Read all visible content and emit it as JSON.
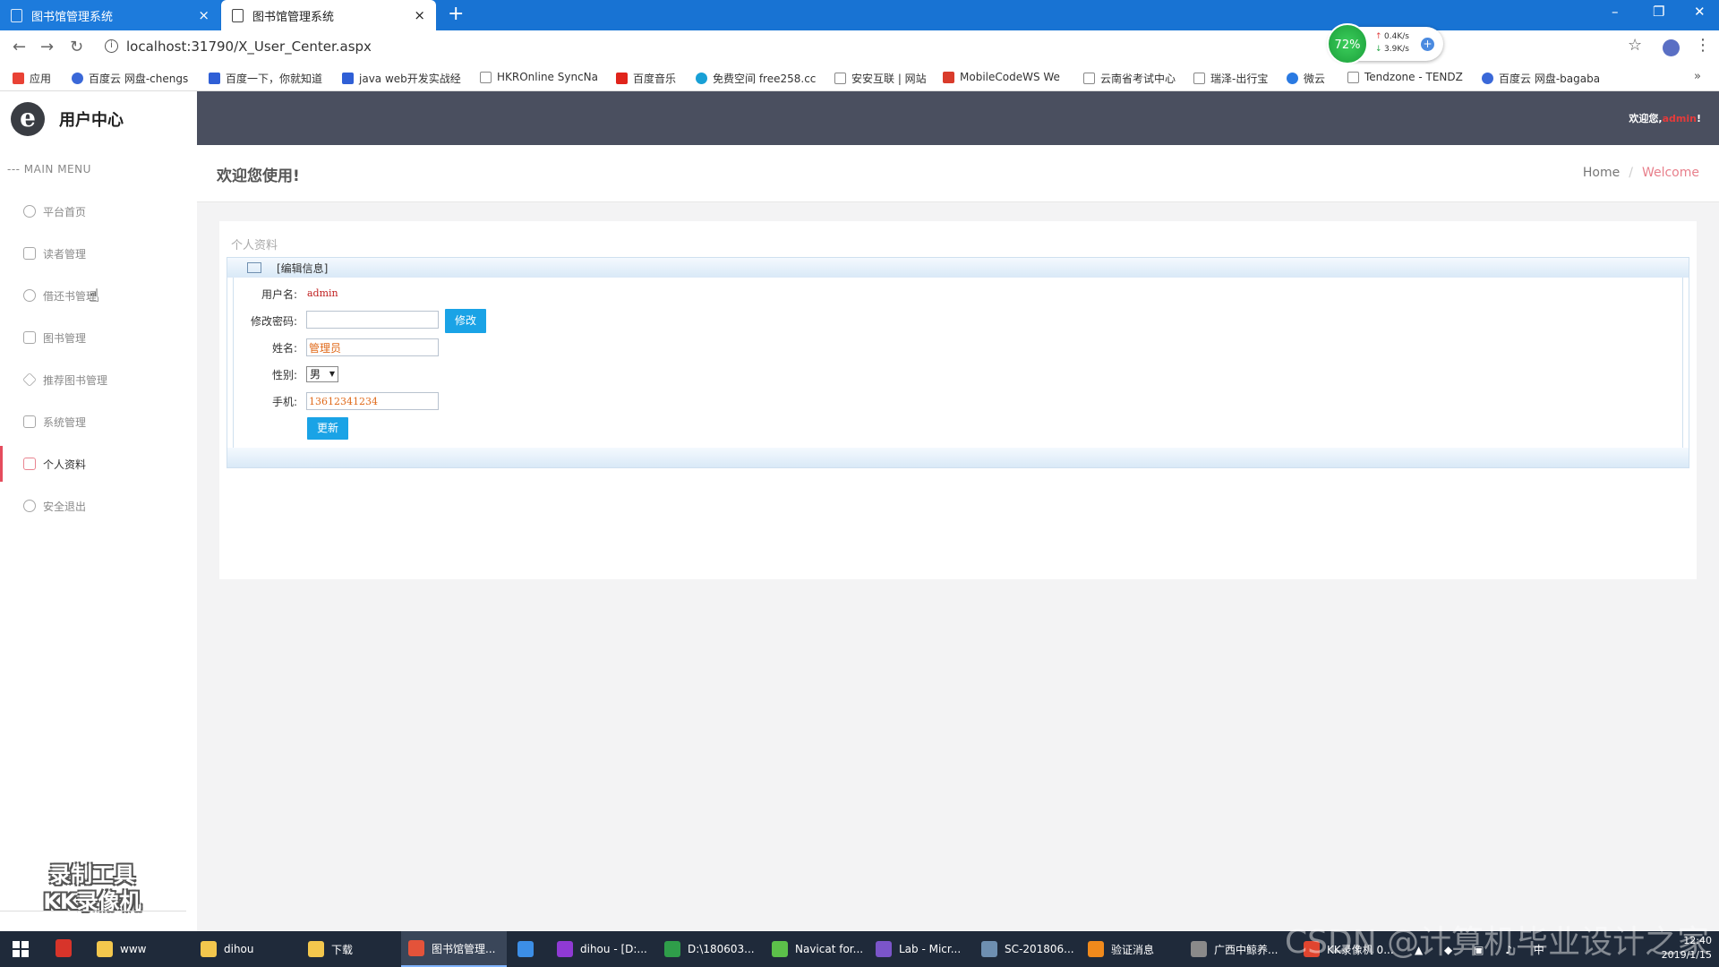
{
  "browser": {
    "tabs": [
      {
        "title": "图书馆管理系统",
        "active": false
      },
      {
        "title": "图书馆管理系统",
        "active": true
      }
    ],
    "new_tab": "+",
    "url": "localhost:31790/X_User_Center.aspx",
    "speed": {
      "percent": "72%",
      "up": "0.4K/s",
      "down": "3.9K/s"
    },
    "bookmarks": [
      {
        "label": "应用",
        "icon": "apps-grid-icon",
        "color": "#e94235"
      },
      {
        "label": "百度云 网盘-chengs",
        "icon": "baidu-cloud-icon",
        "color": "#3a68d8"
      },
      {
        "label": "百度一下，你就知道",
        "icon": "baidu-paw-icon",
        "color": "#2f5fd6"
      },
      {
        "label": "java web开发实战经",
        "icon": "baidu-paw-icon",
        "color": "#2f5fd6"
      },
      {
        "label": "HKROnline SyncNa",
        "icon": "page-icon",
        "color": "#888888"
      },
      {
        "label": "百度音乐",
        "icon": "music-icon",
        "color": "#e0241b"
      },
      {
        "label": "免费空间 free258.cc",
        "icon": "circle-icon",
        "color": "#18a0d6"
      },
      {
        "label": "安安互联 | 网站",
        "icon": "page-icon",
        "color": "#888888"
      },
      {
        "label": "MobileCodeWS We",
        "icon": "mobilecode-icon",
        "color": "#d93b2b"
      },
      {
        "label": "云南省考试中心",
        "icon": "page-icon",
        "color": "#888888"
      },
      {
        "label": "瑞泽-出行宝",
        "icon": "page-icon",
        "color": "#888888"
      },
      {
        "label": "微云",
        "icon": "weiyun-icon",
        "color": "#2a7ae2"
      },
      {
        "label": "Tendzone - TENDZ",
        "icon": "page-icon",
        "color": "#888888"
      },
      {
        "label": "百度云 网盘-bagaba",
        "icon": "baidu-cloud-icon",
        "color": "#3a68d8"
      }
    ],
    "bookmarks_more": "»"
  },
  "sidebar": {
    "title": "用户中心",
    "logo_letter": "e",
    "menu_header": "--- MAIN MENU",
    "items": [
      {
        "label": "平台首页",
        "icon": "eye-icon",
        "active": false
      },
      {
        "label": "读者管理",
        "icon": "cloud-icon",
        "active": false
      },
      {
        "label": "借还书管理",
        "icon": "compass-icon",
        "active": false
      },
      {
        "label": "图书管理",
        "icon": "trophy-icon",
        "active": false
      },
      {
        "label": "推荐图书管理",
        "icon": "diamond-icon",
        "active": false
      },
      {
        "label": "系统管理",
        "icon": "monitor-icon",
        "active": false
      },
      {
        "label": "个人资料",
        "icon": "comment-icon",
        "active": true
      },
      {
        "label": "安全退出",
        "icon": "power-icon",
        "active": false
      }
    ],
    "watermark_line1": "录制工具",
    "watermark_line2": "KK录像机"
  },
  "header": {
    "welcome_prefix": "欢迎您,",
    "username": "admin",
    "welcome_suffix": "!"
  },
  "page": {
    "title": "欢迎您使用!",
    "breadcrumb": {
      "home": "Home",
      "separator": "/",
      "current": "Welcome"
    }
  },
  "profile": {
    "section_title": "个人资料",
    "edit_header": "[编辑信息]",
    "username_label": "用户名:",
    "username_value": "admin",
    "password_label": "修改密码:",
    "password_value": "",
    "modify_button": "修改",
    "name_label": "姓名:",
    "name_value": "管理员",
    "gender_label": "性别:",
    "gender_value": "男",
    "phone_label": "手机:",
    "phone_value": "13612341234",
    "update_button": "更新"
  },
  "taskbar": {
    "items": [
      {
        "label": "www",
        "color": "#f3c74d"
      },
      {
        "label": "dihou",
        "color": "#f3c74d"
      },
      {
        "label": "下载",
        "color": "#f3c74d"
      },
      {
        "label": "图书馆管理...",
        "color": "#e4533a",
        "active": true
      },
      {
        "label": "",
        "color": "#3c8ee6"
      },
      {
        "label": "dihou - [D:...",
        "color": "#8f3ad4"
      },
      {
        "label": "D:\\180603...",
        "color": "#2f9e4a"
      },
      {
        "label": "Navicat for...",
        "color": "#5cc04a"
      },
      {
        "label": "Lab - Micr...",
        "color": "#7b55c9"
      },
      {
        "label": "SC-201806...",
        "color": "#6e8fb1"
      },
      {
        "label": "验证消息",
        "color": "#f08a1c"
      },
      {
        "label": "广西中鲸养...",
        "color": "#8a8a8a"
      },
      {
        "label": "KK录像机 0...",
        "color": "#e0452f"
      }
    ],
    "time": "12:40",
    "date": "2019/1/15",
    "watermark": "CSDN @计算机毕业设计之家"
  },
  "colors": {
    "topnav": "#4a4f5f",
    "accent_blue": "#1aa3e6",
    "active_red": "#e54c5d",
    "browser_blue": "#1873d3"
  }
}
